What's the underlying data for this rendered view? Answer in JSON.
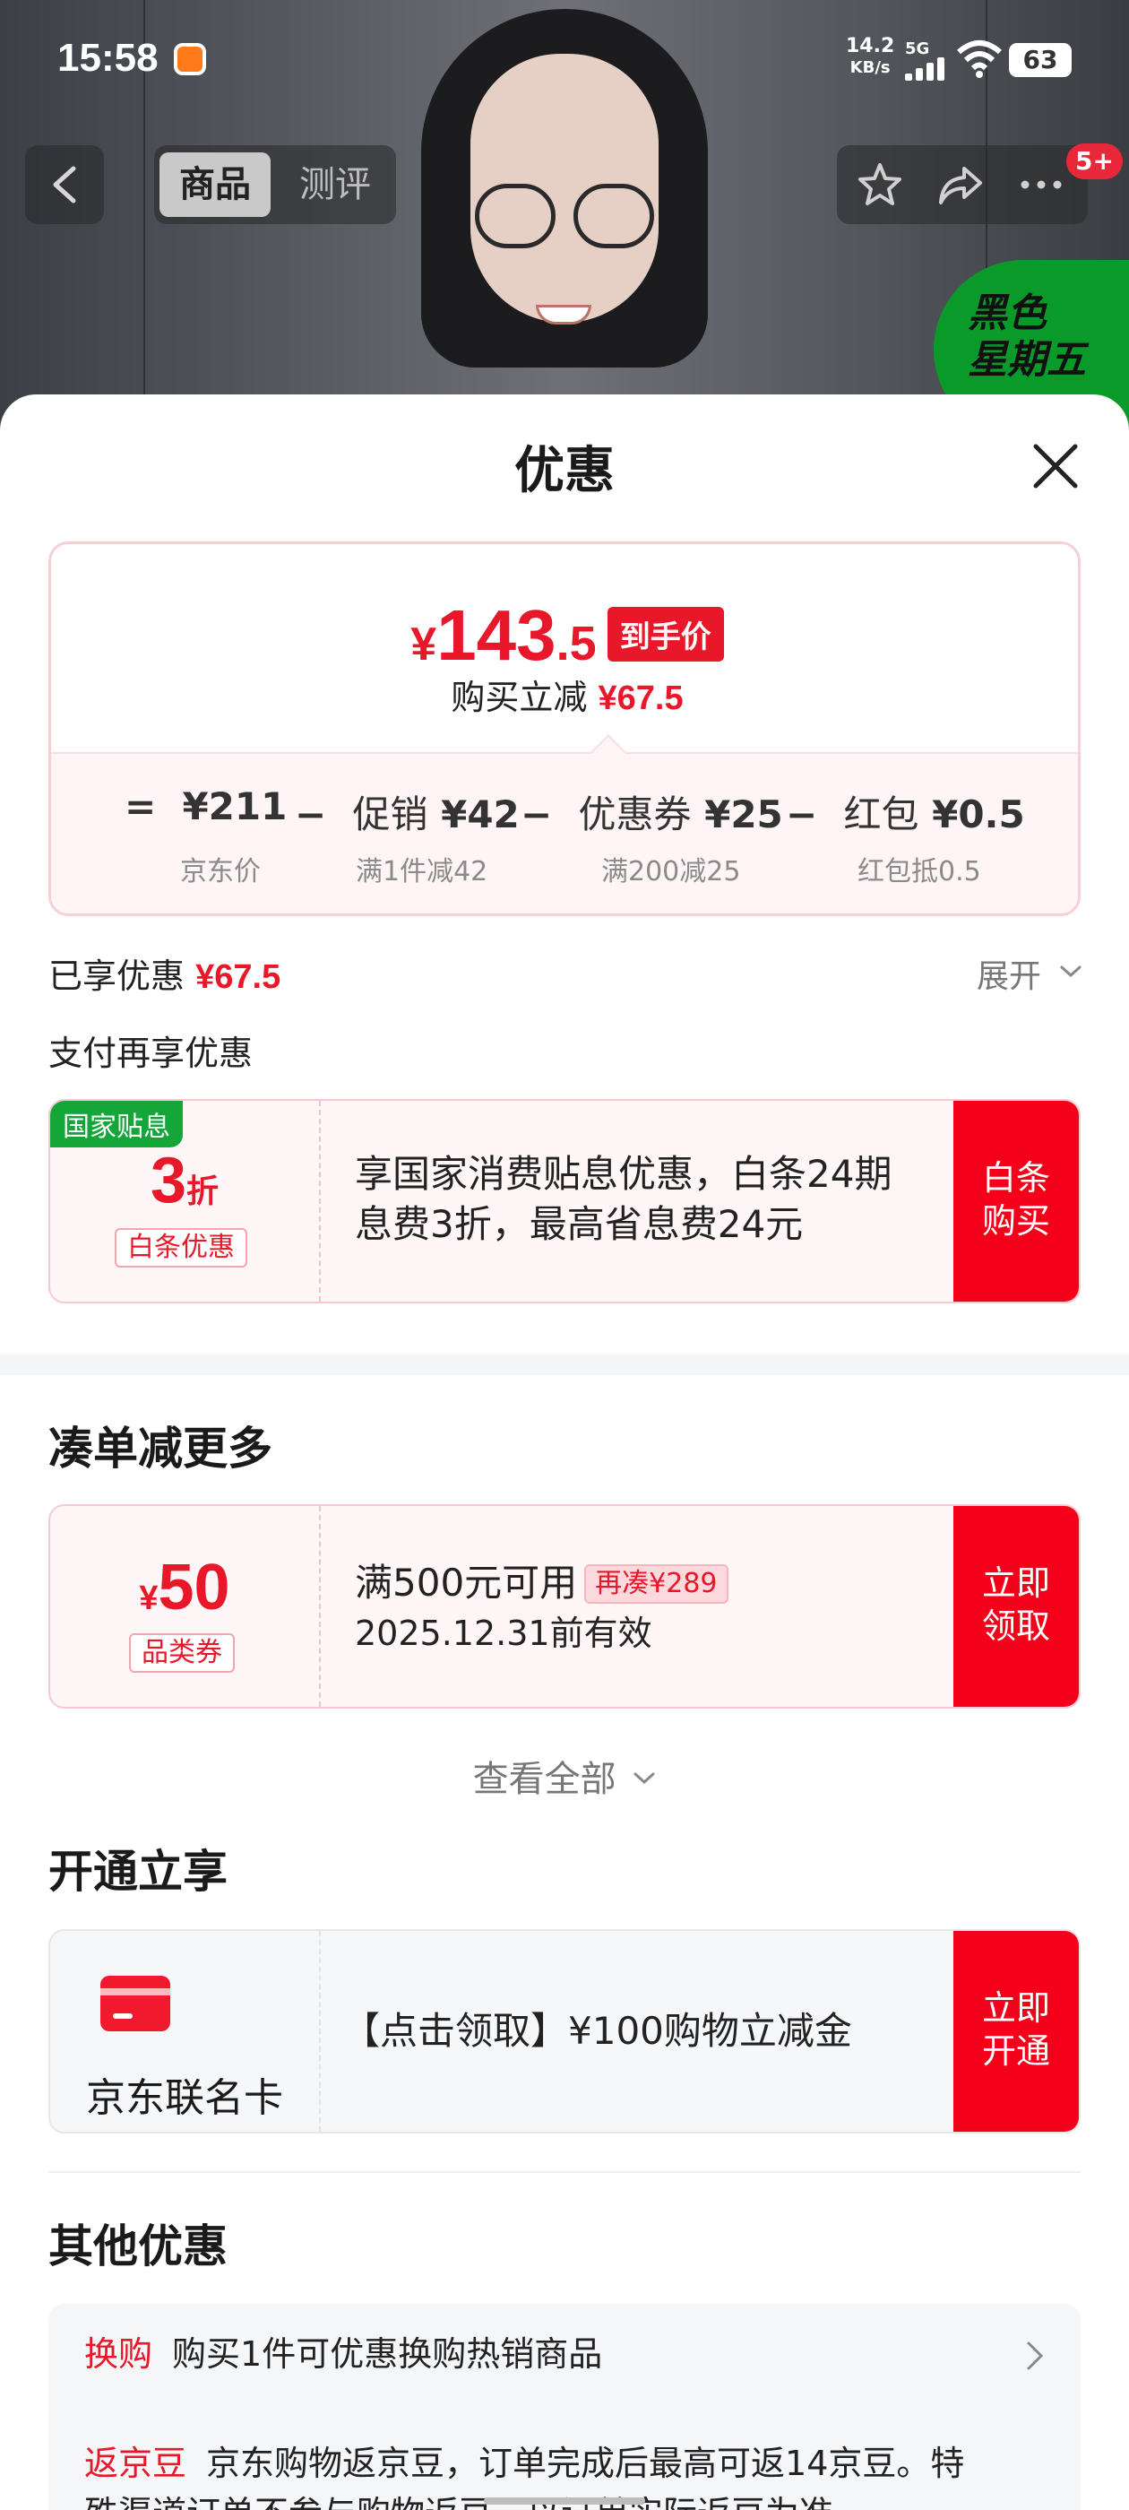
{
  "status_bar": {
    "time": "15:58",
    "net_speed_value": "14.2",
    "net_speed_unit": "KB/s",
    "network": "5G",
    "battery": "63"
  },
  "nav": {
    "tabs": [
      {
        "label": "商品"
      },
      {
        "label": "测评"
      }
    ],
    "more_badge": "5+"
  },
  "banner": {
    "text": "黑色\n星期五"
  },
  "sheet": {
    "title": "优惠",
    "price": {
      "currency": "¥",
      "integer": "143",
      "decimal": ".5",
      "tag": "到手价",
      "reduce_label": "购买立减",
      "reduce_value": "¥67.5"
    },
    "breakdown": [
      {
        "op": "=",
        "label": "",
        "value": "¥211",
        "sub": "京东价"
      },
      {
        "op": "−",
        "label": "促销",
        "value": "¥42",
        "sub": "满1件减42"
      },
      {
        "op": "−",
        "label": "优惠券",
        "value": "¥25",
        "sub": "满200减25"
      },
      {
        "op": "−",
        "label": "红包",
        "value": "¥0.5",
        "sub": "红包抵0.5"
      }
    ],
    "enjoyed_label": "已享优惠",
    "enjoyed_value": "¥67.5",
    "expand_label": "展开",
    "pay_more_label": "支付再享优惠",
    "baitiao": {
      "corner_tag": "国家贴息",
      "discount_num": "3",
      "discount_unit": "折",
      "pill": "白条优惠",
      "line1": "享国家消费贴息优惠，白条24期",
      "line2": "息费3折，最高省息费24元",
      "cta_line1": "白条",
      "cta_line2": "购买"
    },
    "more_section_title": "凑单减更多",
    "category_coupon": {
      "currency": "¥",
      "amount": "50",
      "pill": "品类券",
      "line1": "满500元可用",
      "tag": "再凑¥289",
      "line2": "2025.12.31前有效",
      "cta_line1": "立即",
      "cta_line2": "领取"
    },
    "see_all_label": "查看全部",
    "open_section_title": "开通立享",
    "co_card": {
      "name": "京东联名卡",
      "text": "【点击领取】¥100购物立减金",
      "cta_line1": "立即",
      "cta_line2": "开通"
    },
    "other_section_title": "其他优惠",
    "others": [
      {
        "tag": "换购",
        "text": "购买1件可优惠换购热销商品"
      },
      {
        "tag": "返京豆",
        "text": "京东购物返京豆，订单完成后最高可返14京豆。特",
        "text2": "殊渠道订单不参与购物返豆，以订单实际返豆为准"
      }
    ]
  },
  "colors": {
    "accent": "#e8182a",
    "cta": "#f5001a",
    "green_tag": "#15a63a"
  }
}
